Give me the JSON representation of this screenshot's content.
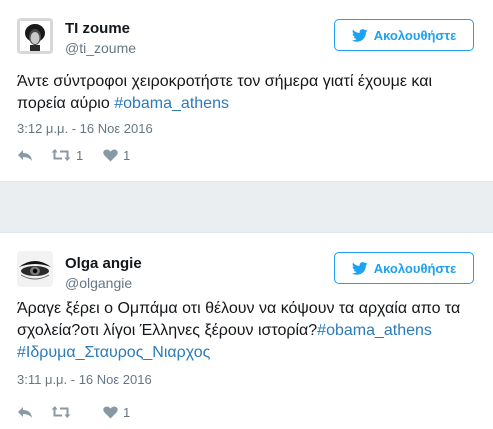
{
  "colors": {
    "link": "#2b7bb9",
    "brand": "#1da1f2",
    "muted": "#657786",
    "icon": "#8899a6"
  },
  "tweets": [
    {
      "display_name": "TI zoume",
      "handle": "@ti_zoume",
      "follow_label": "Ακολουθήστε",
      "text_line1": "Άντε σύντροφοι χειροκροτήστε τον σήμερα γιατί έχουμε και",
      "text_line2_prefix": "πορεία αύριο ",
      "hashtag1": "#obama_athens",
      "timestamp": "3:12 μ.μ. - 16 Νοε 2016",
      "retweets": "1",
      "likes": "1",
      "icons": {
        "reply": "reply-icon",
        "retweet": "retweet-icon",
        "like": "heart-icon",
        "follow": "twitter-bird-icon"
      }
    },
    {
      "display_name": "Olga angie",
      "handle": "@olgangie",
      "follow_label": "Ακολουθήστε",
      "text_line1": "Άραγε ξέρει ο Ομπάμα οτι θέλουν να κόψουν τα αρχαία απο τα",
      "text_line2_prefix": "σχολεία?οτι λίγοι Έλληνες ξέρουν ιστορία?",
      "hashtag1": "#obama_athens",
      "hashtag2": "#Ιδρυμα_Σταυρος_Νιαρχος",
      "timestamp": "3:11 μ.μ. - 16 Νοε 2016",
      "likes": "1",
      "icons": {
        "reply": "reply-icon",
        "retweet": "retweet-icon",
        "like": "heart-icon",
        "follow": "twitter-bird-icon"
      }
    }
  ]
}
